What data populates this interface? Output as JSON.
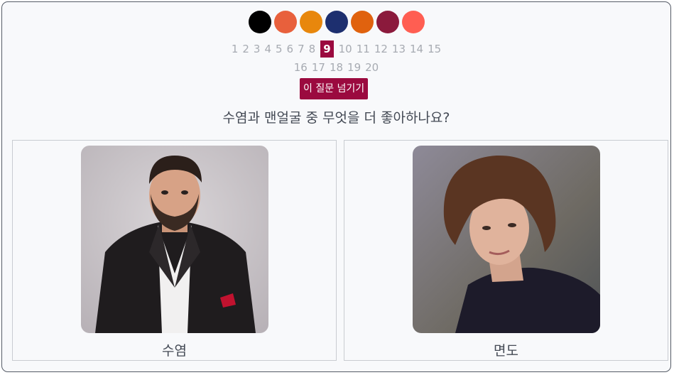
{
  "swatches": [
    "#000000",
    "#e8603c",
    "#e8870c",
    "#1d2f6f",
    "#e0620e",
    "#8b1a3c",
    "#ff5e52"
  ],
  "pagination": {
    "row1": [
      "1",
      "2",
      "3",
      "4",
      "5",
      "6",
      "7",
      "8",
      "9",
      "10",
      "11",
      "12",
      "13",
      "14",
      "15"
    ],
    "row2": [
      "16",
      "17",
      "18",
      "19",
      "20"
    ],
    "current": "9"
  },
  "skip_button": {
    "label": "이 질문 넘기기"
  },
  "question": "수염과 맨얼굴 중 무엇을 더 좋아하나요?",
  "options": [
    {
      "label": "수염"
    },
    {
      "label": "면도"
    }
  ],
  "colors": {
    "accent": "#9b0a3f",
    "text": "#444a55",
    "muted_text": "#a7abb2"
  }
}
